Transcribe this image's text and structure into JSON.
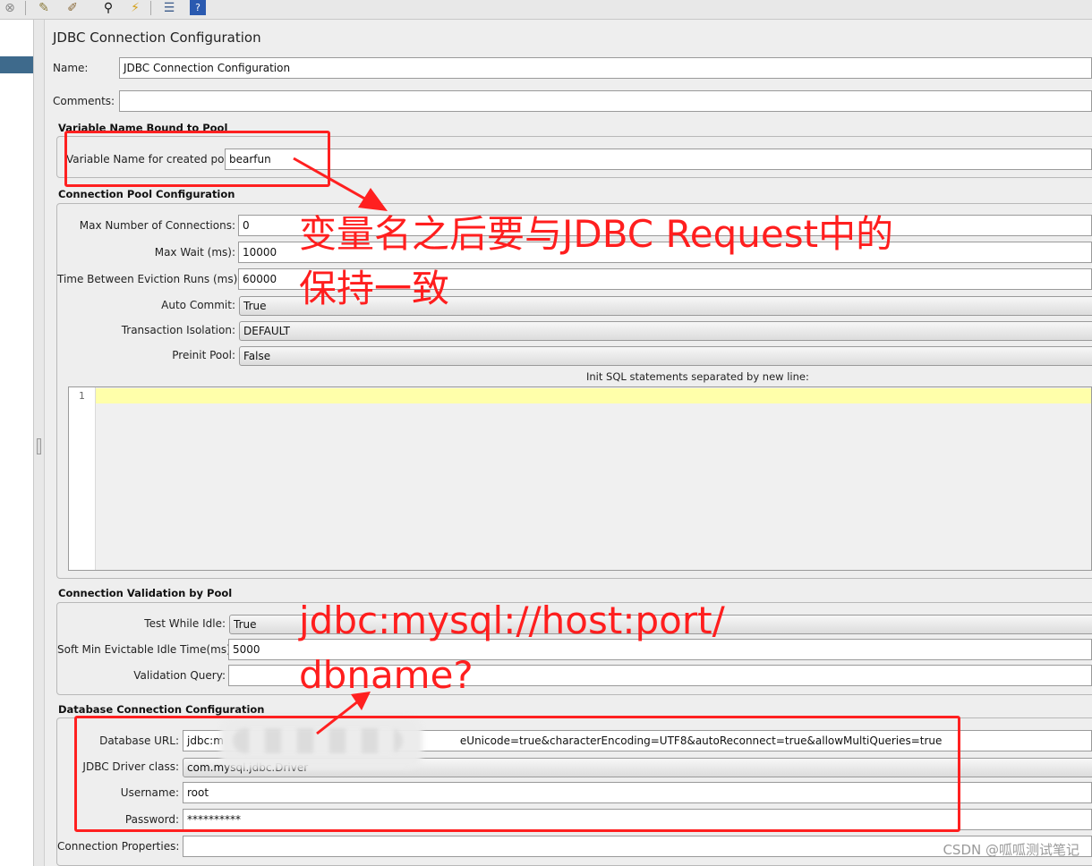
{
  "panel_title": "JDBC Connection Configuration",
  "name": {
    "label": "Name:",
    "value": "JDBC Connection Configuration"
  },
  "comments": {
    "label": "Comments:",
    "value": ""
  },
  "variable_section": {
    "title": "Variable Name Bound to Pool",
    "label": "Variable Name for created pool:",
    "value": "bearfun"
  },
  "pool_section": {
    "title": "Connection Pool Configuration",
    "max_connections": {
      "label": "Max Number of Connections:",
      "value": "0"
    },
    "max_wait": {
      "label": "Max Wait (ms):",
      "value": "10000"
    },
    "eviction": {
      "label": "Time Between Eviction Runs (ms):",
      "value": "60000"
    },
    "auto_commit": {
      "label": "Auto Commit:",
      "value": "True"
    },
    "isolation": {
      "label": "Transaction Isolation:",
      "value": "DEFAULT"
    },
    "preinit": {
      "label": "Preinit Pool:",
      "value": "False"
    },
    "init_sql_label": "Init SQL statements separated by new line:",
    "line_number": "1"
  },
  "validation_section": {
    "title": "Connection Validation by Pool",
    "test_while_idle": {
      "label": "Test While Idle:",
      "value": "True"
    },
    "soft_min": {
      "label": "Soft Min Evictable Idle Time(ms):",
      "value": "5000"
    },
    "validation_query": {
      "label": "Validation Query:",
      "value": ""
    }
  },
  "db_section": {
    "title": "Database Connection Configuration",
    "url": {
      "label": "Database URL:",
      "value_start": "jdbc:m",
      "value_end": "eUnicode=true&characterEncoding=UTF8&autoReconnect=true&allowMultiQueries=true"
    },
    "driver": {
      "label": "JDBC Driver class:",
      "value": "com.mysql.jdbc.Driver"
    },
    "username": {
      "label": "Username:",
      "value": "root"
    },
    "password": {
      "label": "Password:",
      "value": "**********"
    },
    "properties": {
      "label": "Connection Properties:",
      "value": ""
    }
  },
  "annotations": {
    "top_line1": "变量名之后要与JDBC Request中的",
    "top_line2": "保持一致",
    "bottom_line1": "jdbc:mysql://host:port/",
    "bottom_line2": "dbname?"
  },
  "watermark": "CSDN @呱呱测试笔记",
  "colors": {
    "annotation_red": "#ff2020",
    "tree_selection": "#3e6a8c",
    "editor_current_line": "#ffffaa"
  }
}
